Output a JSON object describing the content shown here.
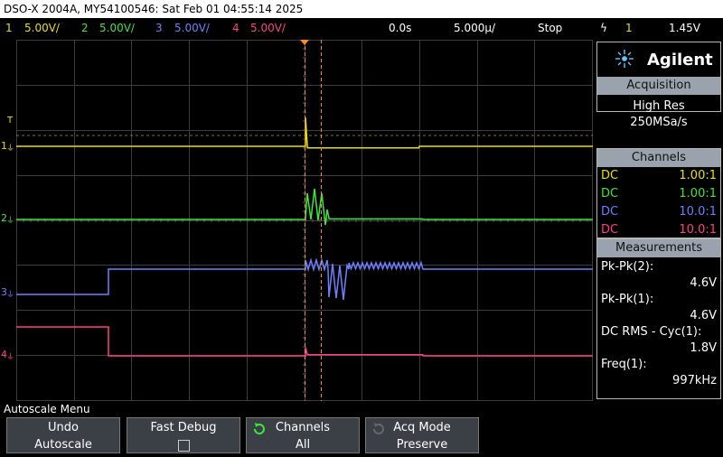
{
  "title_bar": "DSO-X 2004A, MY54100546: Sat Feb 01 04:55:14 2025",
  "status": {
    "ch1": {
      "num": "1",
      "scale": "5.00V/"
    },
    "ch2": {
      "num": "2",
      "scale": "5.00V/"
    },
    "ch3": {
      "num": "3",
      "scale": "5.00V/"
    },
    "ch4": {
      "num": "4",
      "scale": "5.00V/"
    },
    "delay": "0.0s",
    "timebase": "5.000µ/",
    "run_state": "Stop",
    "trigger_icon": "ϟ",
    "trigger_source": "1",
    "trigger_level": "1.45V"
  },
  "plot": {
    "channel_markers": [
      "1",
      "2",
      "3",
      "4"
    ],
    "trigger_marker": "T"
  },
  "right_panel": {
    "logo": "Agilent",
    "acquisition": {
      "header": "Acquisition",
      "mode": "High Res",
      "rate": "250MSa/s"
    },
    "channels": {
      "header": "Channels",
      "rows": [
        {
          "coupling": "DC",
          "probe": "1.00:1",
          "color": "#e8e000"
        },
        {
          "coupling": "DC",
          "probe": "1.00:1",
          "color": "#3ce63c"
        },
        {
          "coupling": "DC",
          "probe": "10.0:1",
          "color": "#6d80ff"
        },
        {
          "coupling": "DC",
          "probe": "10.0:1",
          "color": "#ff3d8e"
        }
      ]
    },
    "measurements": {
      "header": "Measurements",
      "items": [
        {
          "label": "Pk-Pk(2):",
          "value": "4.6V"
        },
        {
          "label": "Pk-Pk(1):",
          "value": "4.6V"
        },
        {
          "label": "DC RMS - Cyc(1):",
          "value": "1.8V"
        },
        {
          "label": "Freq(1):",
          "value": "997kHz"
        }
      ]
    }
  },
  "menu_title": "Autoscale Menu",
  "softkeys": [
    {
      "line1": "Undo",
      "line2": "Autoscale"
    },
    {
      "line1": "Fast Debug",
      "line2": ""
    },
    {
      "line1": "Channels",
      "line2": "All"
    },
    {
      "line1": "Acq Mode",
      "line2": "Preserve"
    }
  ],
  "colors": {
    "ch1": "#e8e000",
    "ch2": "#3ce63c",
    "ch3": "#6d80ff",
    "ch4": "#ff3d8e",
    "grid": "#3c3c3c",
    "cursor": "#ff8c1a",
    "panel_header": "#9aa3ad"
  }
}
